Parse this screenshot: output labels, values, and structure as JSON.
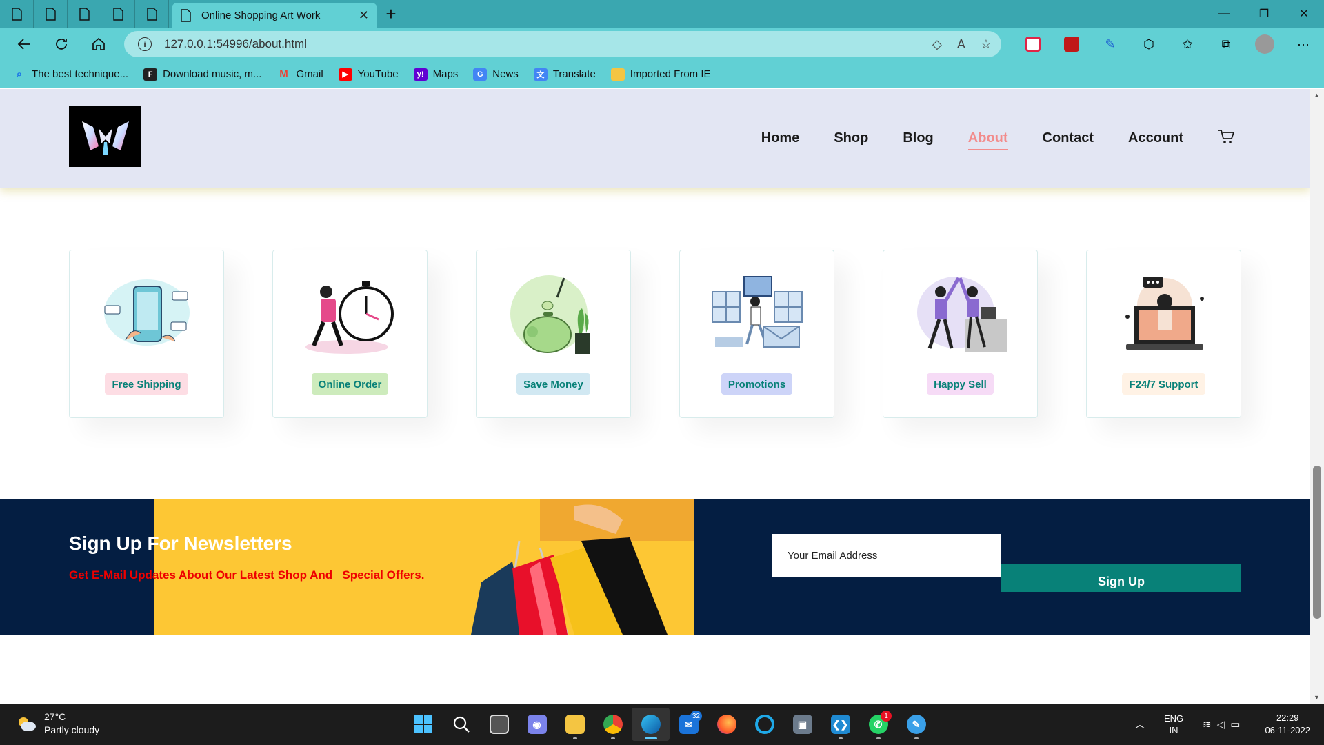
{
  "browser": {
    "tab_title": "Online Shopping Art Work",
    "tab_close": "✕",
    "new_tab": "+",
    "url": "127.0.0.1:54996/about.html",
    "window_controls": {
      "minimize": "—",
      "maximize": "❐",
      "close": "✕"
    }
  },
  "bookmarks": [
    {
      "label": "The best technique...",
      "icon": "search-icon",
      "color": "#1a73e8"
    },
    {
      "label": "Download music, m...",
      "icon": "f-icon",
      "color": "#222222"
    },
    {
      "label": "Gmail",
      "icon": "gmail-icon",
      "color": "#ea4335"
    },
    {
      "label": "YouTube",
      "icon": "youtube-icon",
      "color": "#ff0000"
    },
    {
      "label": "Maps",
      "icon": "yahoo-icon",
      "color": "#6001d2"
    },
    {
      "label": "News",
      "icon": "news-icon",
      "color": "#4285f4"
    },
    {
      "label": "Translate",
      "icon": "translate-icon",
      "color": "#4285f4"
    },
    {
      "label": "Imported From IE",
      "icon": "folder-icon",
      "color": "#f4c542"
    }
  ],
  "site": {
    "nav": {
      "home": "Home",
      "shop": "Shop",
      "blog": "Blog",
      "about": "About",
      "contact": "Contact",
      "account": "Account"
    },
    "active_nav": "About",
    "accent": "#088178",
    "active_color": "#f28c8c"
  },
  "features": [
    {
      "label": "Free Shipping",
      "bg": "#fddde4",
      "icon": "payment-phone-illustration"
    },
    {
      "label": "Online Order",
      "bg": "#cdebbc",
      "icon": "timer-delivery-illustration"
    },
    {
      "label": "Save Money",
      "bg": "#d1e8f2",
      "icon": "piggy-bank-illustration"
    },
    {
      "label": "Promotions",
      "bg": "#cdd4f8",
      "icon": "promotion-gift-illustration"
    },
    {
      "label": "Happy Sell",
      "bg": "#f6dbf6",
      "icon": "high-five-illustration"
    },
    {
      "label": "F24/7 Support",
      "bg": "#fff2e5",
      "icon": "laptop-support-illustration"
    }
  ],
  "newsletter": {
    "title": "Sign Up For Newsletters",
    "subtitle": "Get E-Mail Updates About Our Latest Shop And   Special Offers.",
    "email_placeholder": "Your Email Address",
    "button": "Sign Up"
  },
  "taskbar": {
    "temperature": "27°C",
    "weather": "Partly cloudy",
    "mail_badge": "32",
    "whatsapp_badge": "1",
    "lang_1": "ENG",
    "lang_2": "IN",
    "time": "22:29",
    "date": "06-11-2022"
  }
}
